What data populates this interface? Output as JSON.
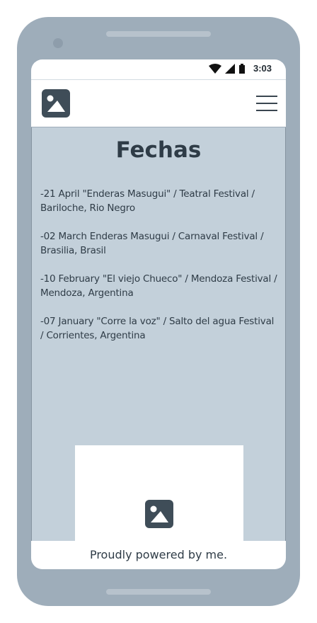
{
  "status_bar": {
    "time": "3:03",
    "icons": [
      "wifi-icon",
      "signal-icon",
      "battery-icon"
    ]
  },
  "app_bar": {
    "logo_icon": "image-placeholder-icon",
    "menu_icon": "hamburger-menu-icon"
  },
  "main": {
    "title": "Fechas",
    "dates": [
      "-21 April \"Enderas Masugui\" / Teatral Festival / Bariloche, Rio Negro",
      "-02 March Enderas Masugui / Carnaval Festival / Brasilia, Brasil",
      "-10 February \"El viejo Chueco\" / Mendoza Festival / Mendoza, Argentina",
      "-07 January \"Corre la voz\" / Salto del agua Festival / Corrientes, Argentina"
    ],
    "image_icon": "image-placeholder-icon"
  },
  "footer": {
    "text": "Proudly powered by me."
  },
  "colors": {
    "device": "#9eadba",
    "screen_background": "#c3d0da",
    "text": "#2f3c47",
    "icon": "#3f4d58"
  }
}
